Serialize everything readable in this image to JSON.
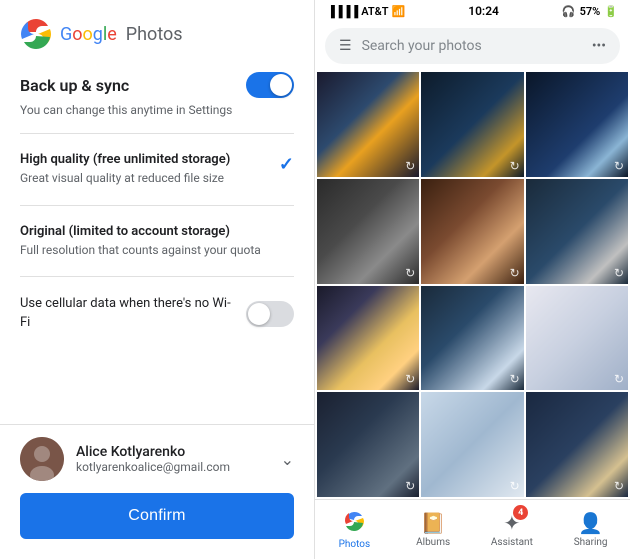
{
  "left": {
    "logo": {
      "google": "Google",
      "photos": "Photos"
    },
    "backup": {
      "title": "Back up & sync",
      "description": "You can change this anytime in Settings",
      "toggle_on": true
    },
    "high_quality": {
      "title": "High quality (free unlimited storage)",
      "description": "Great visual quality at reduced file size",
      "selected": true
    },
    "original": {
      "title": "Original (limited to account storage)",
      "description": "Full resolution that counts against your quota",
      "selected": false
    },
    "cellular": {
      "text": "Use cellular data when there's no Wi-Fi",
      "toggle_on": false
    },
    "account": {
      "name": "Alice Kotlyarenko",
      "email": "kotlyarenkoalice@gmail.com"
    },
    "confirm_button": "Confirm"
  },
  "right": {
    "status_bar": {
      "carrier": "AT&T",
      "time": "10:24",
      "battery": "57%"
    },
    "search": {
      "placeholder": "Search your photos"
    },
    "photos": [
      {
        "id": 1,
        "style": "photo-1",
        "has_sync": true
      },
      {
        "id": 2,
        "style": "photo-2",
        "has_sync": true
      },
      {
        "id": 3,
        "style": "photo-3",
        "has_sync": true
      },
      {
        "id": 4,
        "style": "photo-4",
        "has_sync": true
      },
      {
        "id": 5,
        "style": "photo-5",
        "has_sync": true
      },
      {
        "id": 6,
        "style": "photo-6",
        "has_sync": true
      },
      {
        "id": 7,
        "style": "photo-7",
        "has_sync": true
      },
      {
        "id": 8,
        "style": "photo-8",
        "has_sync": true
      },
      {
        "id": 9,
        "style": "photo-9",
        "has_sync": true
      },
      {
        "id": 10,
        "style": "photo-10",
        "has_sync": true
      },
      {
        "id": 11,
        "style": "photo-11",
        "has_sync": true
      },
      {
        "id": 12,
        "style": "photo-12",
        "has_sync": true
      }
    ],
    "nav": {
      "photos": "Photos",
      "albums": "Albums",
      "assistant": "Assistant",
      "sharing": "Sharing",
      "assistant_badge": "4"
    }
  }
}
